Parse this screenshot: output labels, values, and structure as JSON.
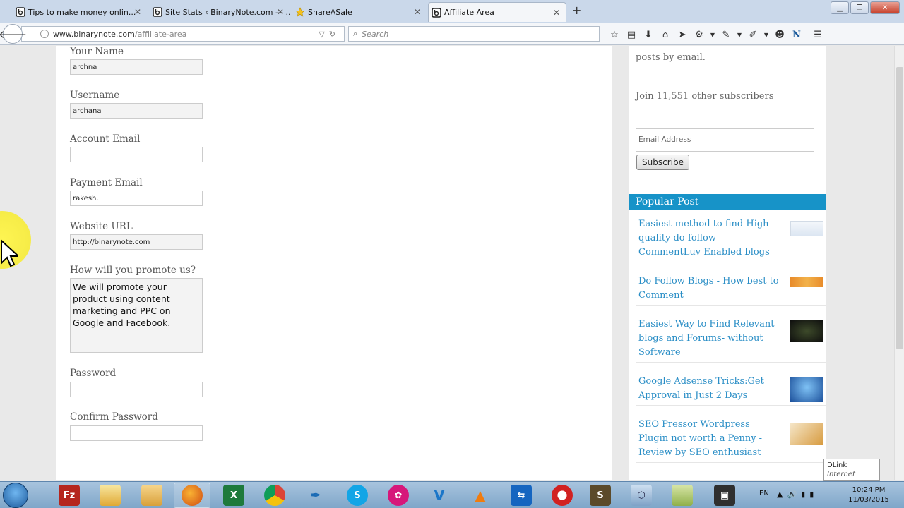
{
  "browser": {
    "tabs": [
      {
        "title": "Tips to make money onlin..."
      },
      {
        "title": "Site Stats ‹ BinaryNote.com — ..."
      },
      {
        "title": "ShareASale"
      },
      {
        "title": "Affiliate Area"
      }
    ],
    "url_domain": "www.binarynote.com",
    "url_path": "/affiliate-area",
    "search_placeholder": "Search"
  },
  "form": {
    "fields": [
      {
        "label": "Your Name",
        "value": "archna"
      },
      {
        "label": "Username",
        "value": "archana"
      },
      {
        "label": "Account Email",
        "value": ""
      },
      {
        "label": "Payment Email",
        "value": "rakesh."
      },
      {
        "label": "Website URL",
        "value": "http://binarynote.com"
      }
    ],
    "promote": {
      "label": "How will you promote us?",
      "value": "We will promote your product using content marketing and PPC on Google and Facebook."
    },
    "password": {
      "label": "Password"
    },
    "confirm_password": {
      "label": "Confirm Password"
    }
  },
  "sidebar": {
    "posts_by_email": "posts by email.",
    "subscribers": "Join 11,551 other subscribers",
    "email_placeholder": "Email Address",
    "subscribe_label": "Subscribe",
    "popular_title": "Popular Post",
    "popular_posts": [
      {
        "title": "Easiest method to find High quality do-follow CommentLuv Enabled blogs"
      },
      {
        "title": "Do Follow Blogs - How best to Comment"
      },
      {
        "title": "Easiest Way to Find Relevant blogs and Forums- without Software"
      },
      {
        "title": "Google Adsense Tricks:Get Approval in Just 2 Days"
      },
      {
        "title": "SEO Pressor Wordpress Plugin not worth a Penny -Review by SEO enthusiast"
      }
    ]
  },
  "network_tooltip": {
    "name": "DLink",
    "status": "Internet access"
  },
  "taskbar": {
    "language": "EN",
    "time": "10:24 PM",
    "date": "11/03/2015"
  }
}
